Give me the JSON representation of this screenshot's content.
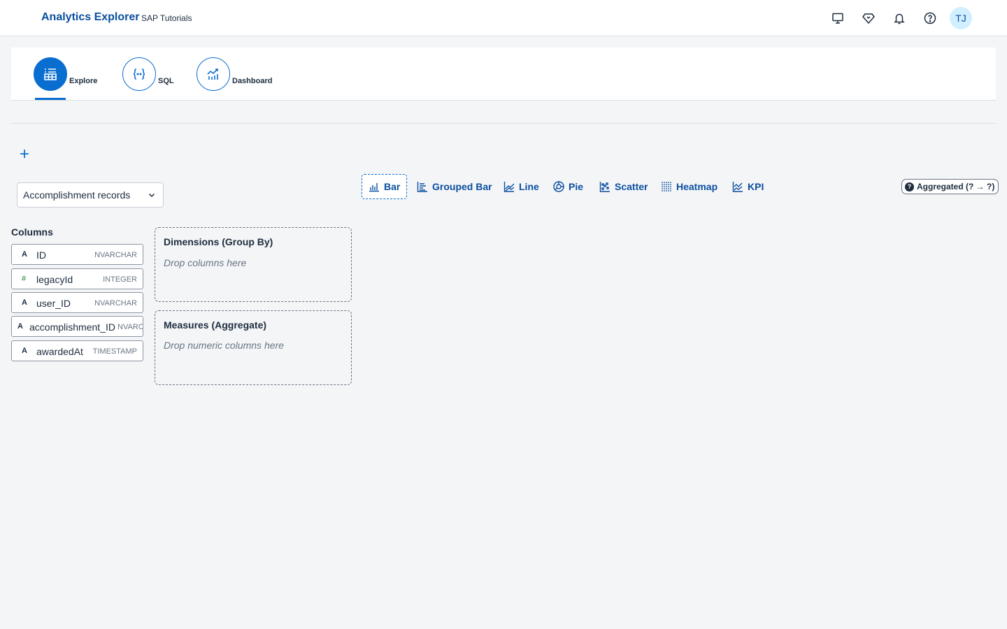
{
  "shell": {
    "title": "Analytics Explorer",
    "subtitle": "SAP Tutorials",
    "actions": [
      "display-icon",
      "diamond-icon",
      "bell-icon",
      "help-icon"
    ],
    "avatar_initials": "TJ"
  },
  "tabs": [
    {
      "label": "Explore",
      "icon": "table-list-icon",
      "active": true
    },
    {
      "label": "SQL",
      "icon": "code-braces-icon",
      "active": false
    },
    {
      "label": "Dashboard",
      "icon": "line-chart-icon",
      "active": false
    }
  ],
  "datasource": {
    "selected": "Accomplishment records"
  },
  "chart_types": [
    {
      "label": "Bar",
      "icon": "bar-chart-icon",
      "active": true
    },
    {
      "label": "Grouped Bar",
      "icon": "grouped-bar-icon",
      "active": false
    },
    {
      "label": "Line",
      "icon": "line-icon",
      "active": false
    },
    {
      "label": "Pie",
      "icon": "pie-icon",
      "active": false
    },
    {
      "label": "Scatter",
      "icon": "scatter-icon",
      "active": false
    },
    {
      "label": "Heatmap",
      "icon": "heatmap-icon",
      "active": false
    },
    {
      "label": "KPI",
      "icon": "kpi-icon",
      "active": false
    }
  ],
  "aggregation_badge": "Aggregated (? → ?)",
  "columns": {
    "title": "Columns",
    "items": [
      {
        "type_icon": "A",
        "name": "ID",
        "dtype": "NVARCHAR"
      },
      {
        "type_icon": "#",
        "name": "legacyId",
        "dtype": "INTEGER"
      },
      {
        "type_icon": "A",
        "name": "user_ID",
        "dtype": "NVARCHAR"
      },
      {
        "type_icon": "A",
        "name": "accomplishment_ID",
        "dtype": "NVARC"
      },
      {
        "type_icon": "A",
        "name": "awardedAt",
        "dtype": "TIMESTAMP"
      }
    ]
  },
  "dimensions": {
    "title": "Dimensions (Group By)",
    "hint": "Drop columns here"
  },
  "measures": {
    "title": "Measures (Aggregate)",
    "hint": "Drop numeric columns here"
  },
  "colors": {
    "brand": "#0a6ed1",
    "title": "#0a4fa0",
    "background": "#f4f5f7"
  }
}
